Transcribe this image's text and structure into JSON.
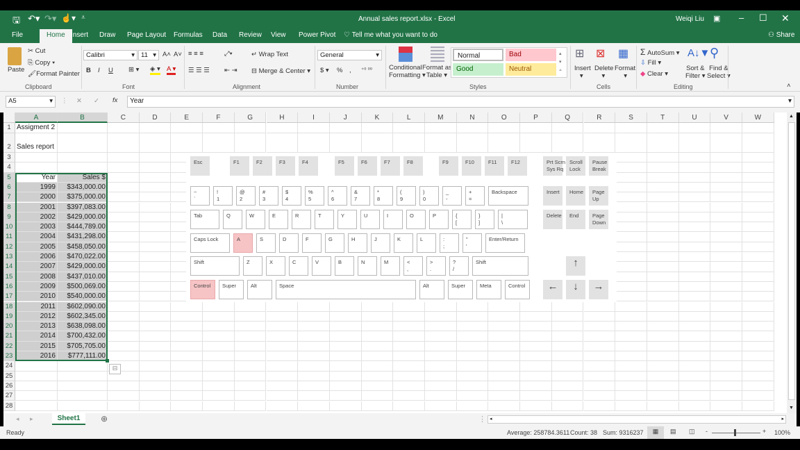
{
  "window": {
    "title": "Annual sales report.xlsx - Excel",
    "user": "Weiqi Liu"
  },
  "qat": {
    "save": "save-icon",
    "undo": "undo-icon",
    "redo": "redo-icon",
    "touch": "touch-mode-icon",
    "customize": "customize-icon"
  },
  "tabs": [
    {
      "label": "File"
    },
    {
      "label": "Home",
      "active": true
    },
    {
      "label": "Insert"
    },
    {
      "label": "Draw"
    },
    {
      "label": "Page Layout"
    },
    {
      "label": "Formulas"
    },
    {
      "label": "Data"
    },
    {
      "label": "Review"
    },
    {
      "label": "View"
    },
    {
      "label": "Power Pivot"
    }
  ],
  "tell_me": "Tell me what you want to do",
  "share": "Share",
  "ribbon": {
    "clipboard": {
      "paste": "Paste",
      "cut": "Cut",
      "copy": "Copy",
      "format_painter": "Format Painter",
      "group": "Clipboard"
    },
    "font": {
      "name": "Calibri",
      "size": "11",
      "bold": "B",
      "italic": "I",
      "underline": "U",
      "group": "Font"
    },
    "alignment": {
      "wrap": "Wrap Text",
      "merge": "Merge & Center",
      "group": "Alignment"
    },
    "number": {
      "format": "General",
      "currency": "$",
      "percent": "%",
      "comma": ",",
      "group": "Number"
    },
    "styles": {
      "conditional": "Conditional",
      "conditional2": "Formatting",
      "format_table": "Format as",
      "format_table2": "Table",
      "normal": "Normal",
      "bad": "Bad",
      "good": "Good",
      "neutral": "Neutral",
      "group": "Styles"
    },
    "cells": {
      "insert": "Insert",
      "delete": "Delete",
      "format": "Format",
      "group": "Cells"
    },
    "editing": {
      "autosum": "AutoSum",
      "fill": "Fill",
      "clear": "Clear",
      "sort": "Sort &",
      "sort2": "Filter",
      "find": "Find &",
      "find2": "Select",
      "group": "Editing"
    }
  },
  "formula_bar": {
    "name_box": "A5",
    "fx": "fx",
    "value": "Year"
  },
  "columns": [
    "A",
    "B",
    "C",
    "D",
    "E",
    "F",
    "G",
    "H",
    "I",
    "J",
    "K",
    "L",
    "M",
    "N",
    "O",
    "P",
    "Q",
    "R",
    "S",
    "T",
    "U",
    "V",
    "W"
  ],
  "rows": [
    "1",
    "2",
    "3",
    "4",
    "5",
    "6",
    "7",
    "8",
    "9",
    "10",
    "11",
    "12",
    "13",
    "14",
    "15",
    "16",
    "17",
    "18",
    "19",
    "20",
    "21",
    "22",
    "23",
    "24",
    "25",
    "26",
    "27",
    "28"
  ],
  "cells": {
    "A1": "Assigment 2",
    "A2": "Sales report",
    "A5": "Year",
    "B5": "Sales $",
    "data": [
      [
        "1999",
        "$343,000.00"
      ],
      [
        "2000",
        "$375,000.00"
      ],
      [
        "2001",
        "$397,083.00"
      ],
      [
        "2002",
        "$429,000.00"
      ],
      [
        "2003",
        "$444,789.00"
      ],
      [
        "2004",
        "$431,298.00"
      ],
      [
        "2005",
        "$458,050.00"
      ],
      [
        "2006",
        "$470,022.00"
      ],
      [
        "2007",
        "$429,000.00"
      ],
      [
        "2008",
        "$437,010.00"
      ],
      [
        "2009",
        "$500,069.00"
      ],
      [
        "2010",
        "$540,000.00"
      ],
      [
        "2011",
        "$602,090.00"
      ],
      [
        "2012",
        "$602,345.00"
      ],
      [
        "2013",
        "$638,098.00"
      ],
      [
        "2014",
        "$700,432.00"
      ],
      [
        "2015",
        "$705,705.00"
      ],
      [
        "2016",
        "$777,111.00"
      ]
    ]
  },
  "selection": "A5:B23",
  "keyboard": {
    "fn_row": [
      "Esc",
      "F1",
      "F2",
      "F3",
      "F4",
      "F5",
      "F6",
      "F7",
      "F8",
      "F9",
      "F10",
      "F11",
      "F12"
    ],
    "nav_top": [
      "Prt Scrn\nSys Rq",
      "Scroll\nLock",
      "Pause\nBreak"
    ],
    "number_row": [
      "~\n`",
      "!\n1",
      "@\n2",
      "#\n3",
      "$\n4",
      "%\n5",
      "^\n6",
      "&\n7",
      "*\n8",
      "(\n9",
      ")\n0",
      "_\n-",
      "+\n=",
      "Backspace"
    ],
    "tab_row": [
      "Tab",
      "Q",
      "W",
      "E",
      "R",
      "T",
      "Y",
      "U",
      "I",
      "O",
      "P",
      "{\n[",
      "}\n]",
      "|\n\\"
    ],
    "caps_row": [
      "Caps Lock",
      "A",
      "S",
      "D",
      "F",
      "G",
      "H",
      "J",
      "K",
      "L",
      ":\n;",
      "\"\n'",
      "Enter/Return"
    ],
    "shift_row": [
      "Shift",
      "Z",
      "X",
      "C",
      "V",
      "B",
      "N",
      "M",
      "<\n,",
      ">\n.",
      "?\n/",
      "Shift"
    ],
    "bottom_row": [
      "Control",
      "Super",
      "Alt",
      "Space",
      "Alt",
      "Super",
      "Meta",
      "Control"
    ],
    "nav_mid1": [
      "Insert",
      "Home",
      "Page\nUp"
    ],
    "nav_mid2": [
      "Delete",
      "End",
      "Page\nDown"
    ],
    "arrows": {
      "up": "↑",
      "left": "←",
      "down": "↓",
      "right": "→"
    },
    "pressed": [
      "A",
      "Control-left"
    ],
    "pressed_color": "#f7c4c6"
  },
  "sheet_tabs": [
    {
      "label": "Sheet1",
      "active": true
    }
  ],
  "status": {
    "ready": "Ready",
    "average": "Average: 258784.3611",
    "count": "Count: 38",
    "sum": "Sum: 9316237",
    "zoom": "100%"
  },
  "colors": {
    "accent": "#217346",
    "selection": "#cfcfcf",
    "bad_bg": "#ffc7ce",
    "good_bg": "#c6efce",
    "neutral_bg": "#ffeb9c"
  }
}
